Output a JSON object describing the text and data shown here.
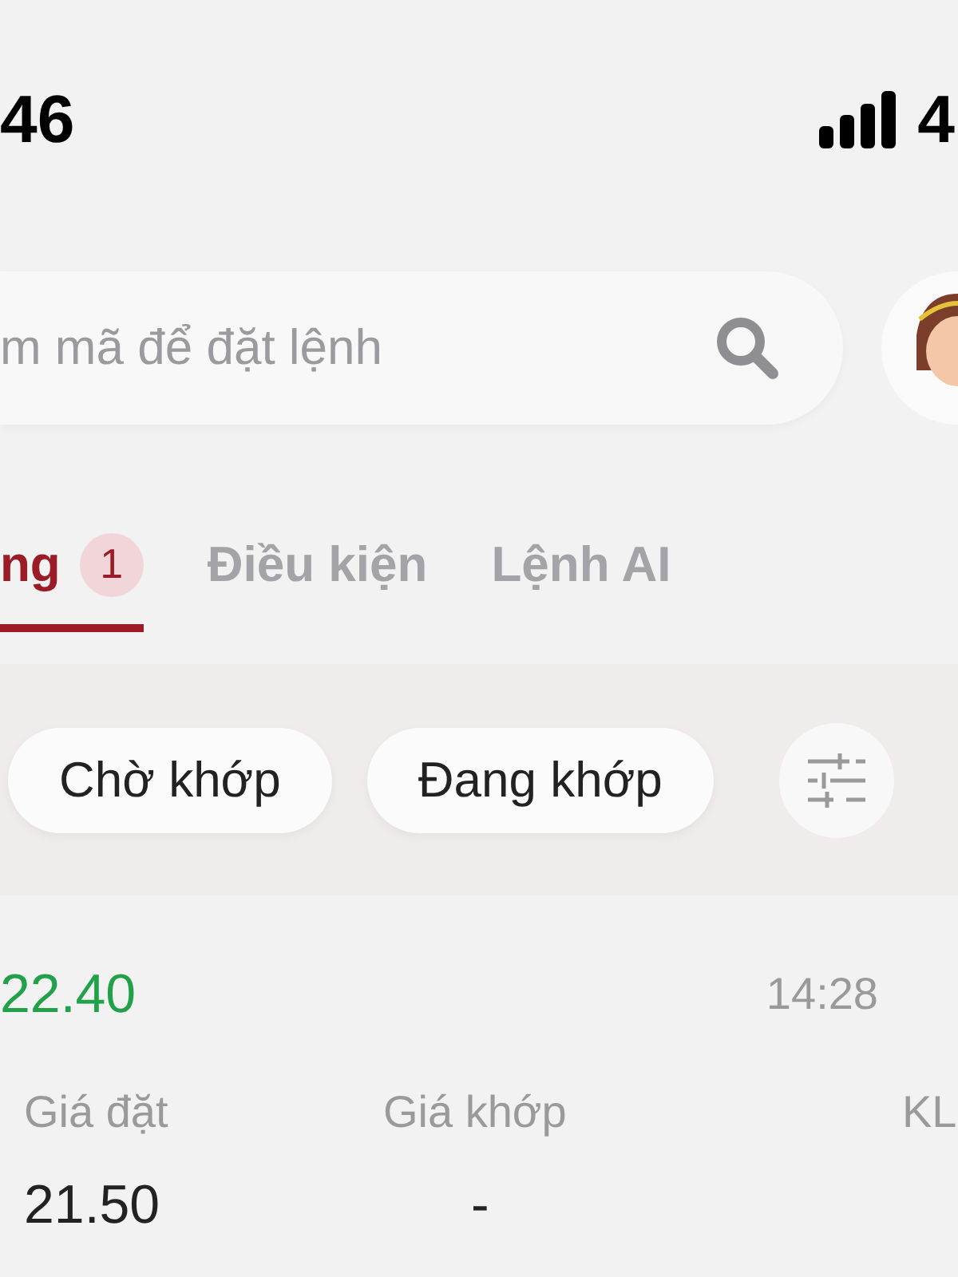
{
  "status_bar": {
    "time": "46",
    "battery": "4"
  },
  "search": {
    "placeholder": "m mã để đặt lệnh"
  },
  "tabs": [
    {
      "label": "ng",
      "badge": "1",
      "selected": true
    },
    {
      "label": "Điều kiện",
      "selected": false
    },
    {
      "label": "Lệnh AI",
      "selected": false
    }
  ],
  "filters": [
    {
      "label": "Chờ khớp",
      "selected": false
    },
    {
      "label": "Đang khớp",
      "selected": false
    }
  ],
  "order": {
    "price": "22.40",
    "time": "14:28",
    "columns": [
      {
        "label": "Giá đặt",
        "value": "21.50"
      },
      {
        "label": "Giá khớp",
        "value": "-"
      },
      {
        "label": "KL"
      }
    ]
  }
}
